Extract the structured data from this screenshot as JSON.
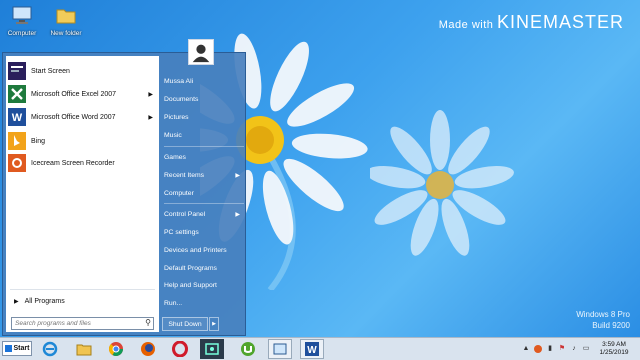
{
  "desktop": {
    "icons": [
      {
        "label": "Computer",
        "icon": "computer-icon"
      },
      {
        "label": "New folder",
        "icon": "folder-icon"
      }
    ],
    "watermark": {
      "prefix": "Made with ",
      "brand": "KINEMASTER"
    },
    "os_version": {
      "line1": "Windows 8 Pro",
      "line2": "Build 9200"
    }
  },
  "start_menu": {
    "programs": [
      {
        "label": "Start Screen",
        "icon": "start-screen-icon",
        "has_submenu": false
      },
      {
        "label": "Microsoft Office Excel 2007",
        "icon": "excel-icon",
        "has_submenu": true
      },
      {
        "label": "Microsoft Office Word 2007",
        "icon": "word-icon",
        "has_submenu": true
      },
      {
        "label": "Bing",
        "icon": "bing-icon",
        "has_submenu": false
      },
      {
        "label": "Icecream Screen Recorder",
        "icon": "icecream-recorder-icon",
        "has_submenu": false
      }
    ],
    "all_programs": "All Programs",
    "search_placeholder": "Search programs and files",
    "right_items": [
      {
        "label": "Mussa Ali",
        "submenu": false
      },
      {
        "label": "Documents",
        "submenu": false
      },
      {
        "label": "Pictures",
        "submenu": false
      },
      {
        "label": "Music",
        "submenu": false
      },
      {
        "label": "Games",
        "submenu": false
      },
      {
        "label": "Recent Items",
        "submenu": true
      },
      {
        "label": "Computer",
        "submenu": false
      },
      {
        "label": "Control Panel",
        "submenu": true
      },
      {
        "label": "PC settings",
        "submenu": false
      },
      {
        "label": "Devices and Printers",
        "submenu": false
      },
      {
        "label": "Default Programs",
        "submenu": false
      },
      {
        "label": "Help and Support",
        "submenu": false
      },
      {
        "label": "Run...",
        "submenu": false
      }
    ],
    "shutdown_label": "Shut Down"
  },
  "taskbar": {
    "start_label": "Start",
    "apps": [
      "internet-explorer-icon",
      "file-explorer-icon",
      "chrome-icon",
      "firefox-icon",
      "opera-icon",
      "screen-recorder-icon",
      "utorrent-icon",
      "windows-explorer-icon",
      "word-icon"
    ],
    "clock": {
      "time": "3:59 AM",
      "date": "1/25/2019"
    }
  },
  "colors": {
    "accent": "#4880be",
    "desktop": "#3da1ee",
    "taskbar": "#d9e3ee"
  }
}
